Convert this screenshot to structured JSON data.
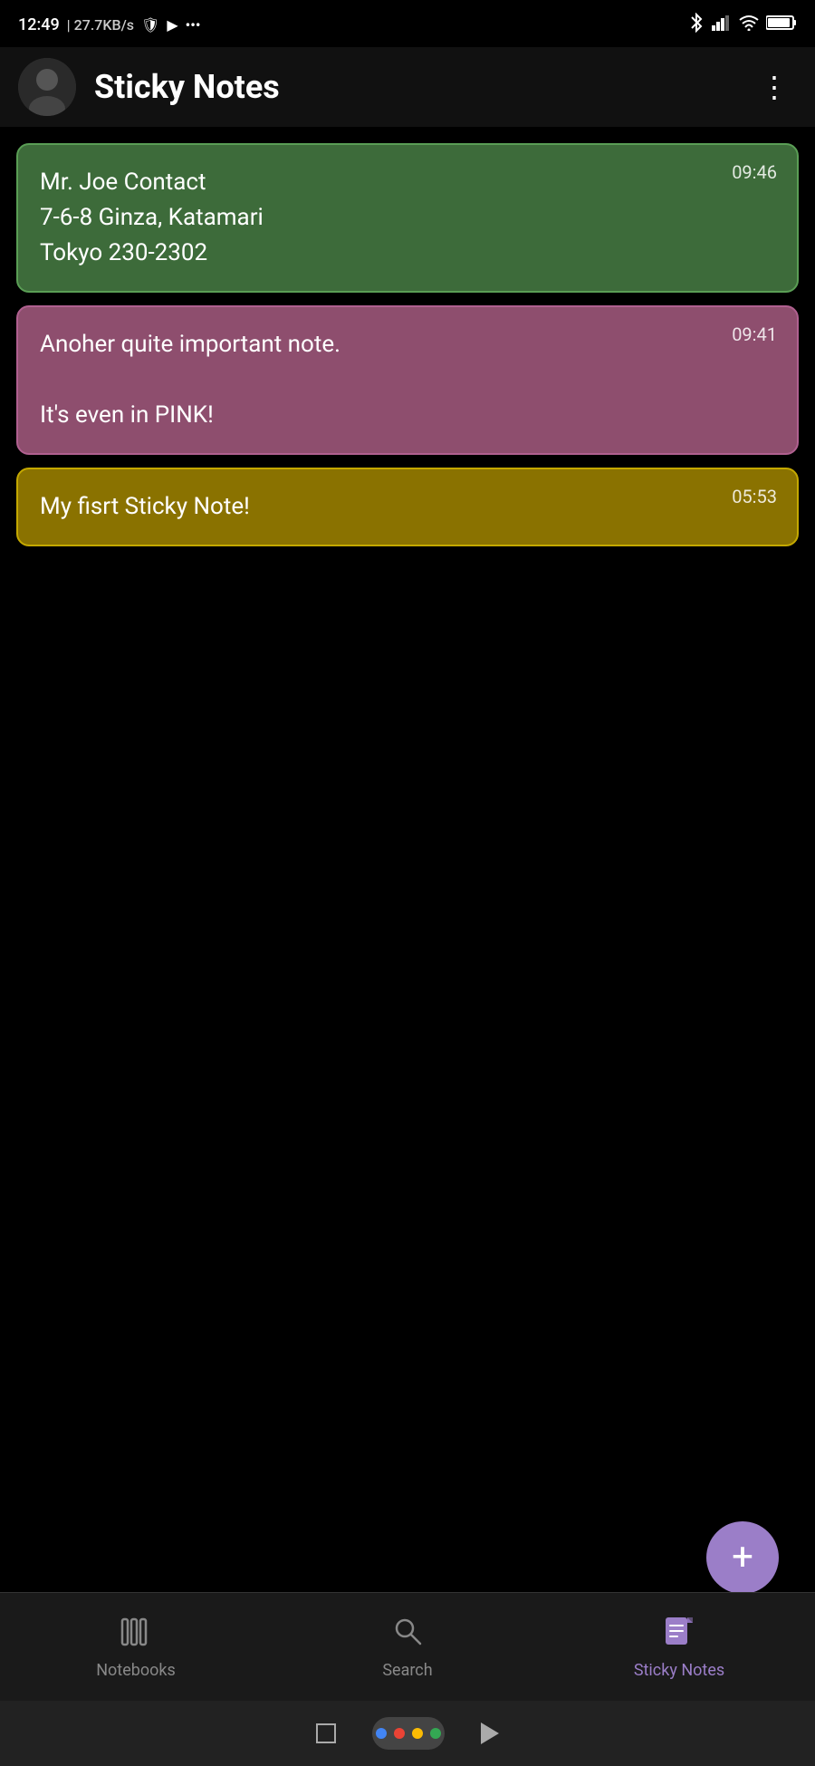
{
  "statusBar": {
    "time": "12:49",
    "network": "27.7KB/s",
    "appTitle": "Sticky Notes"
  },
  "header": {
    "title": "Sticky Notes",
    "moreIconLabel": "more-options"
  },
  "notes": [
    {
      "id": "note-1",
      "color": "green",
      "time": "09:46",
      "text": "Mr. Joe Contact\n7-6-8 Ginza, Katamari\nTokyo 230-2302"
    },
    {
      "id": "note-2",
      "color": "pink",
      "time": "09:41",
      "text": "Anoher quite important note.\n\nIt's even in PINK!"
    },
    {
      "id": "note-3",
      "color": "yellow",
      "time": "05:53",
      "text": "My fisrt Sticky Note!"
    }
  ],
  "fab": {
    "label": "+"
  },
  "bottomNav": {
    "items": [
      {
        "id": "notebooks",
        "label": "Notebooks",
        "active": false
      },
      {
        "id": "search",
        "label": "Search",
        "active": false
      },
      {
        "id": "sticky-notes",
        "label": "Sticky Notes",
        "active": true
      }
    ]
  },
  "sysNav": {
    "dots": [
      "#4285f4",
      "#ea4335",
      "#fbbc04",
      "#34a853"
    ]
  }
}
